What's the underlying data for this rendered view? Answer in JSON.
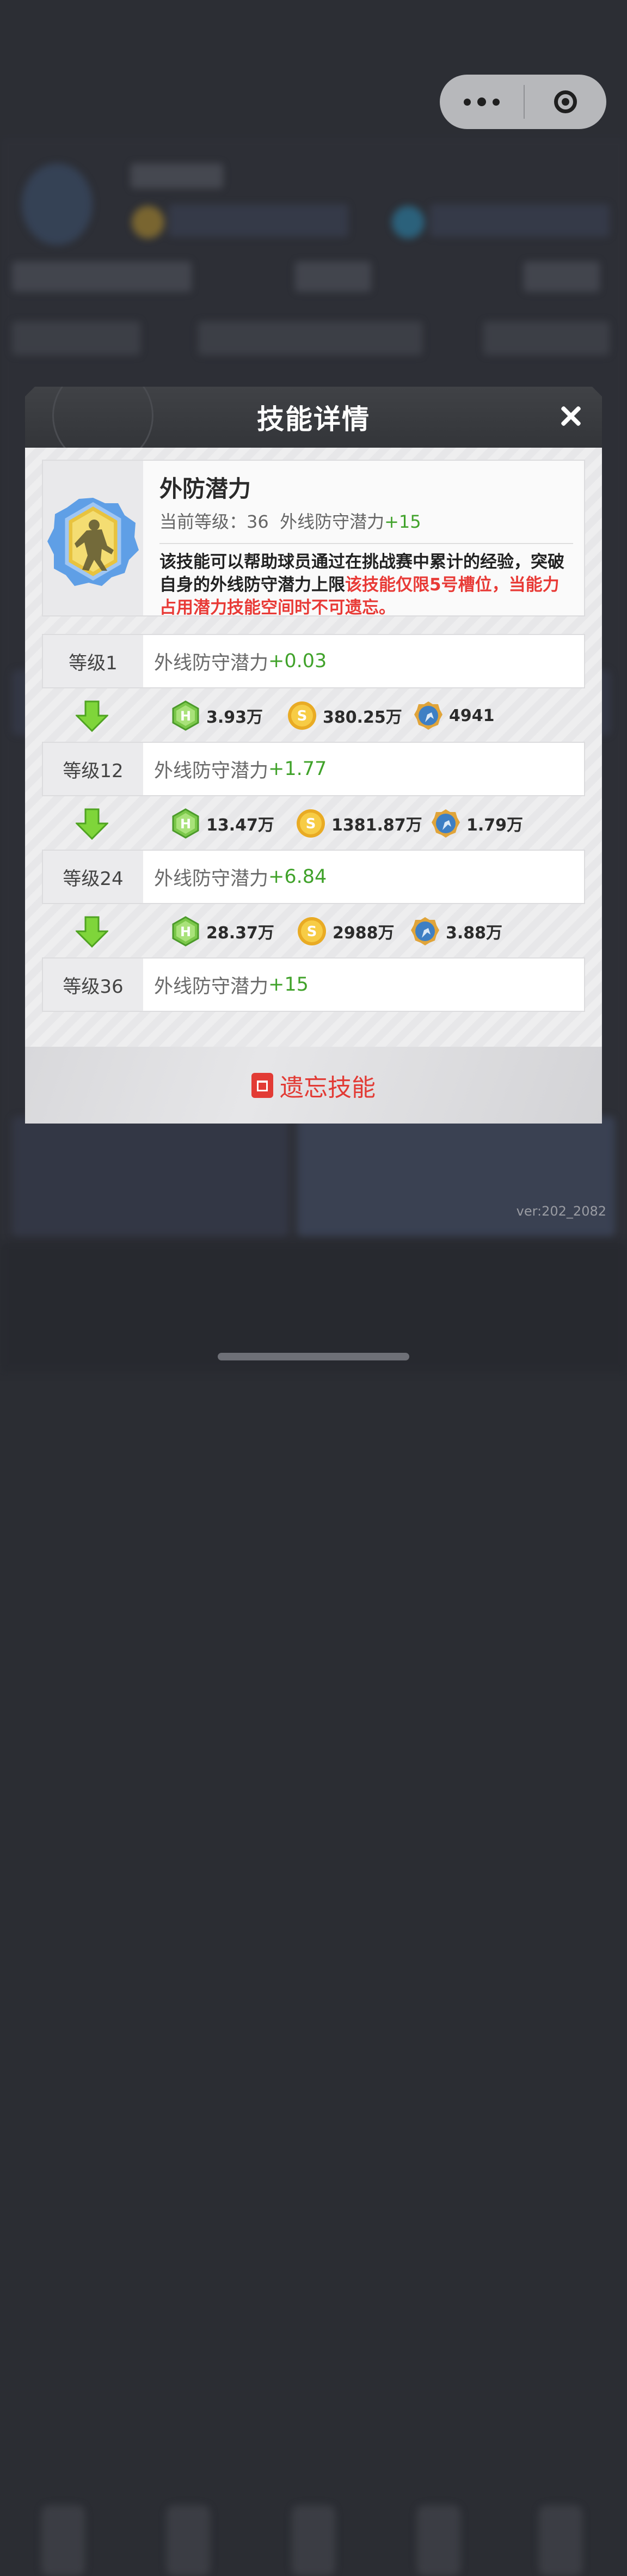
{
  "capsule": {
    "more_icon": "more-dots-icon",
    "close_icon": "target-circle-icon"
  },
  "version": "ver:202_2082",
  "modal": {
    "title": "技能详情",
    "close_icon": "close-x-icon",
    "skill": {
      "name": "外防潜力",
      "current_level_label": "当前等级：36",
      "attribute": "外线防守潜力",
      "bonus": "+15",
      "description_black": "该技能可以帮助球员通过在挑战赛中累计的经验，突破自身的外线防守潜力上限",
      "description_red": "该技能仅限5号槽位，当能力占用潜力技能空间时不可遗忘。"
    },
    "levels": [
      {
        "label": "等级1",
        "attribute": "外线防守潜力",
        "bonus": "+0.03"
      },
      {
        "label": "等级12",
        "attribute": "外线防守潜力",
        "bonus": "+1.77"
      },
      {
        "label": "等级24",
        "attribute": "外线防守潜力",
        "bonus": "+6.84"
      },
      {
        "label": "等级36",
        "attribute": "外线防守潜力",
        "bonus": "+15"
      }
    ],
    "costs": [
      {
        "h": "3.93万",
        "coin": "380.25万",
        "card": "4941"
      },
      {
        "h": "13.47万",
        "coin": "1381.87万",
        "card": "1.79万"
      },
      {
        "h": "28.37万",
        "coin": "2988万",
        "card": "3.88万"
      }
    ],
    "forget_button": "遗忘技能",
    "colors": {
      "accent_green": "#40a22a",
      "accent_red": "#e83a36"
    }
  }
}
